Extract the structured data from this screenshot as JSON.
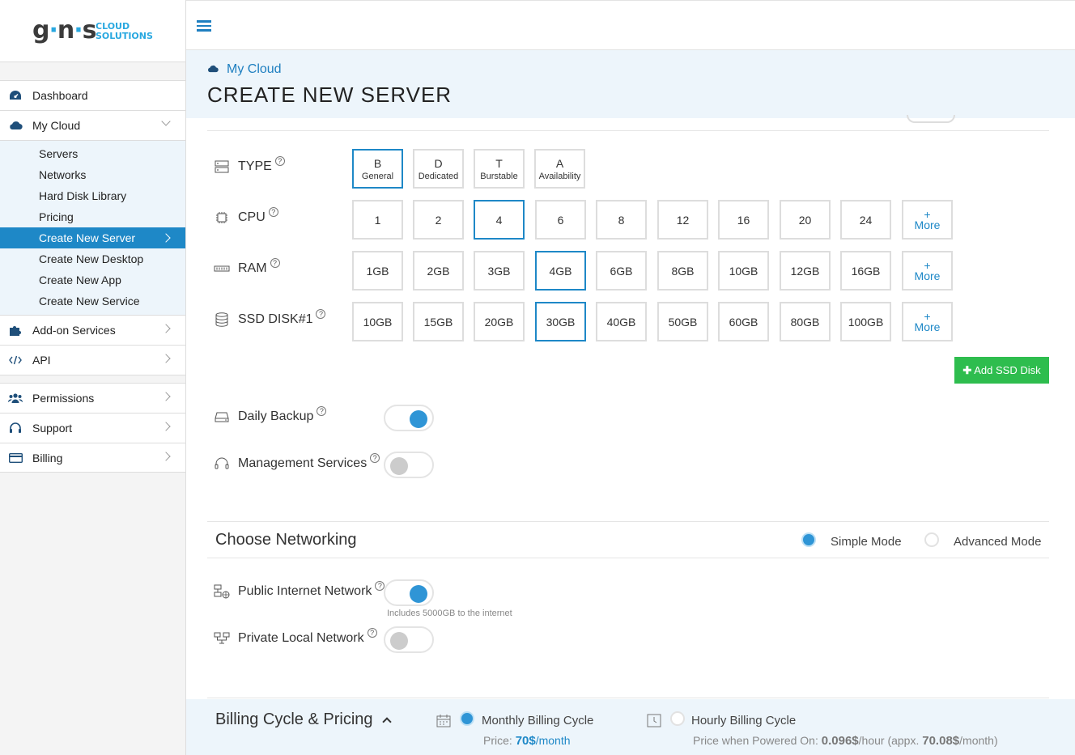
{
  "brand": {
    "logo_main": "gns",
    "logo_sub_line1": "CLOUD",
    "logo_sub_line2": "SOLUTIONS"
  },
  "sidebar": {
    "items": [
      {
        "label": "Dashboard",
        "icon": "dashboard-icon"
      },
      {
        "label": "My Cloud",
        "icon": "cloud-icon"
      }
    ],
    "subitems": [
      "Servers",
      "Networks",
      "Hard Disk Library",
      "Pricing",
      "Create New Server",
      "Create New Desktop",
      "Create New App",
      "Create New Service"
    ],
    "items2": [
      {
        "label": "Add-on Services",
        "icon": "puzzle-icon"
      },
      {
        "label": "API",
        "icon": "code-icon"
      }
    ],
    "items3": [
      {
        "label": "Permissions",
        "icon": "users-icon"
      },
      {
        "label": "Support",
        "icon": "headset-icon"
      },
      {
        "label": "Billing",
        "icon": "credit-card-icon"
      }
    ]
  },
  "header": {
    "breadcrumb": "My Cloud",
    "title": "CREATE NEW SERVER"
  },
  "config": {
    "type": {
      "label": "TYPE",
      "options": [
        {
          "letter": "B",
          "name": "General"
        },
        {
          "letter": "D",
          "name": "Dedicated"
        },
        {
          "letter": "T",
          "name": "Burstable"
        },
        {
          "letter": "A",
          "name": "Availability"
        }
      ],
      "selected": "General"
    },
    "cpu": {
      "label": "CPU",
      "options": [
        "1",
        "2",
        "4",
        "6",
        "8",
        "12",
        "16",
        "20",
        "24"
      ],
      "selected": "4"
    },
    "ram": {
      "label": "RAM",
      "options": [
        "1GB",
        "2GB",
        "3GB",
        "4GB",
        "6GB",
        "8GB",
        "10GB",
        "12GB",
        "16GB"
      ],
      "selected": "4GB"
    },
    "ssd": {
      "label": "SSD DISK#1",
      "options": [
        "10GB",
        "15GB",
        "20GB",
        "30GB",
        "40GB",
        "50GB",
        "60GB",
        "80GB",
        "100GB"
      ],
      "selected": "30GB"
    },
    "more_plus": "+",
    "more_label": "More",
    "help_glyph": "?",
    "add_disk": "Add SSD Disk",
    "daily_backup": {
      "label": "Daily Backup",
      "on": true
    },
    "management": {
      "label": "Management Services",
      "on": false
    }
  },
  "networking": {
    "title": "Choose Networking",
    "simple_mode": "Simple Mode",
    "advanced_mode": "Advanced Mode",
    "selected_mode": "Simple Mode",
    "public": {
      "label": "Public Internet Network",
      "on": true,
      "note": "Includes 5000GB to the internet"
    },
    "private": {
      "label": "Private Local Network",
      "on": false
    }
  },
  "billing": {
    "title": "Billing Cycle & Pricing",
    "monthly": {
      "label": "Monthly Billing Cycle",
      "price_prefix": "Price:",
      "price_value": "70$",
      "price_suffix": "/month",
      "selected": true
    },
    "hourly": {
      "label": "Hourly Billing Cycle",
      "price_prefix": "Price when Powered On:",
      "price_value": "0.096$",
      "price_mid": "/hour (appx.",
      "price_value2": "70.08$",
      "price_suffix": "/month)",
      "selected": false
    }
  },
  "colors": {
    "accent": "#1e88c7",
    "green": "#2ebd4e",
    "panel": "#edf5fb"
  }
}
